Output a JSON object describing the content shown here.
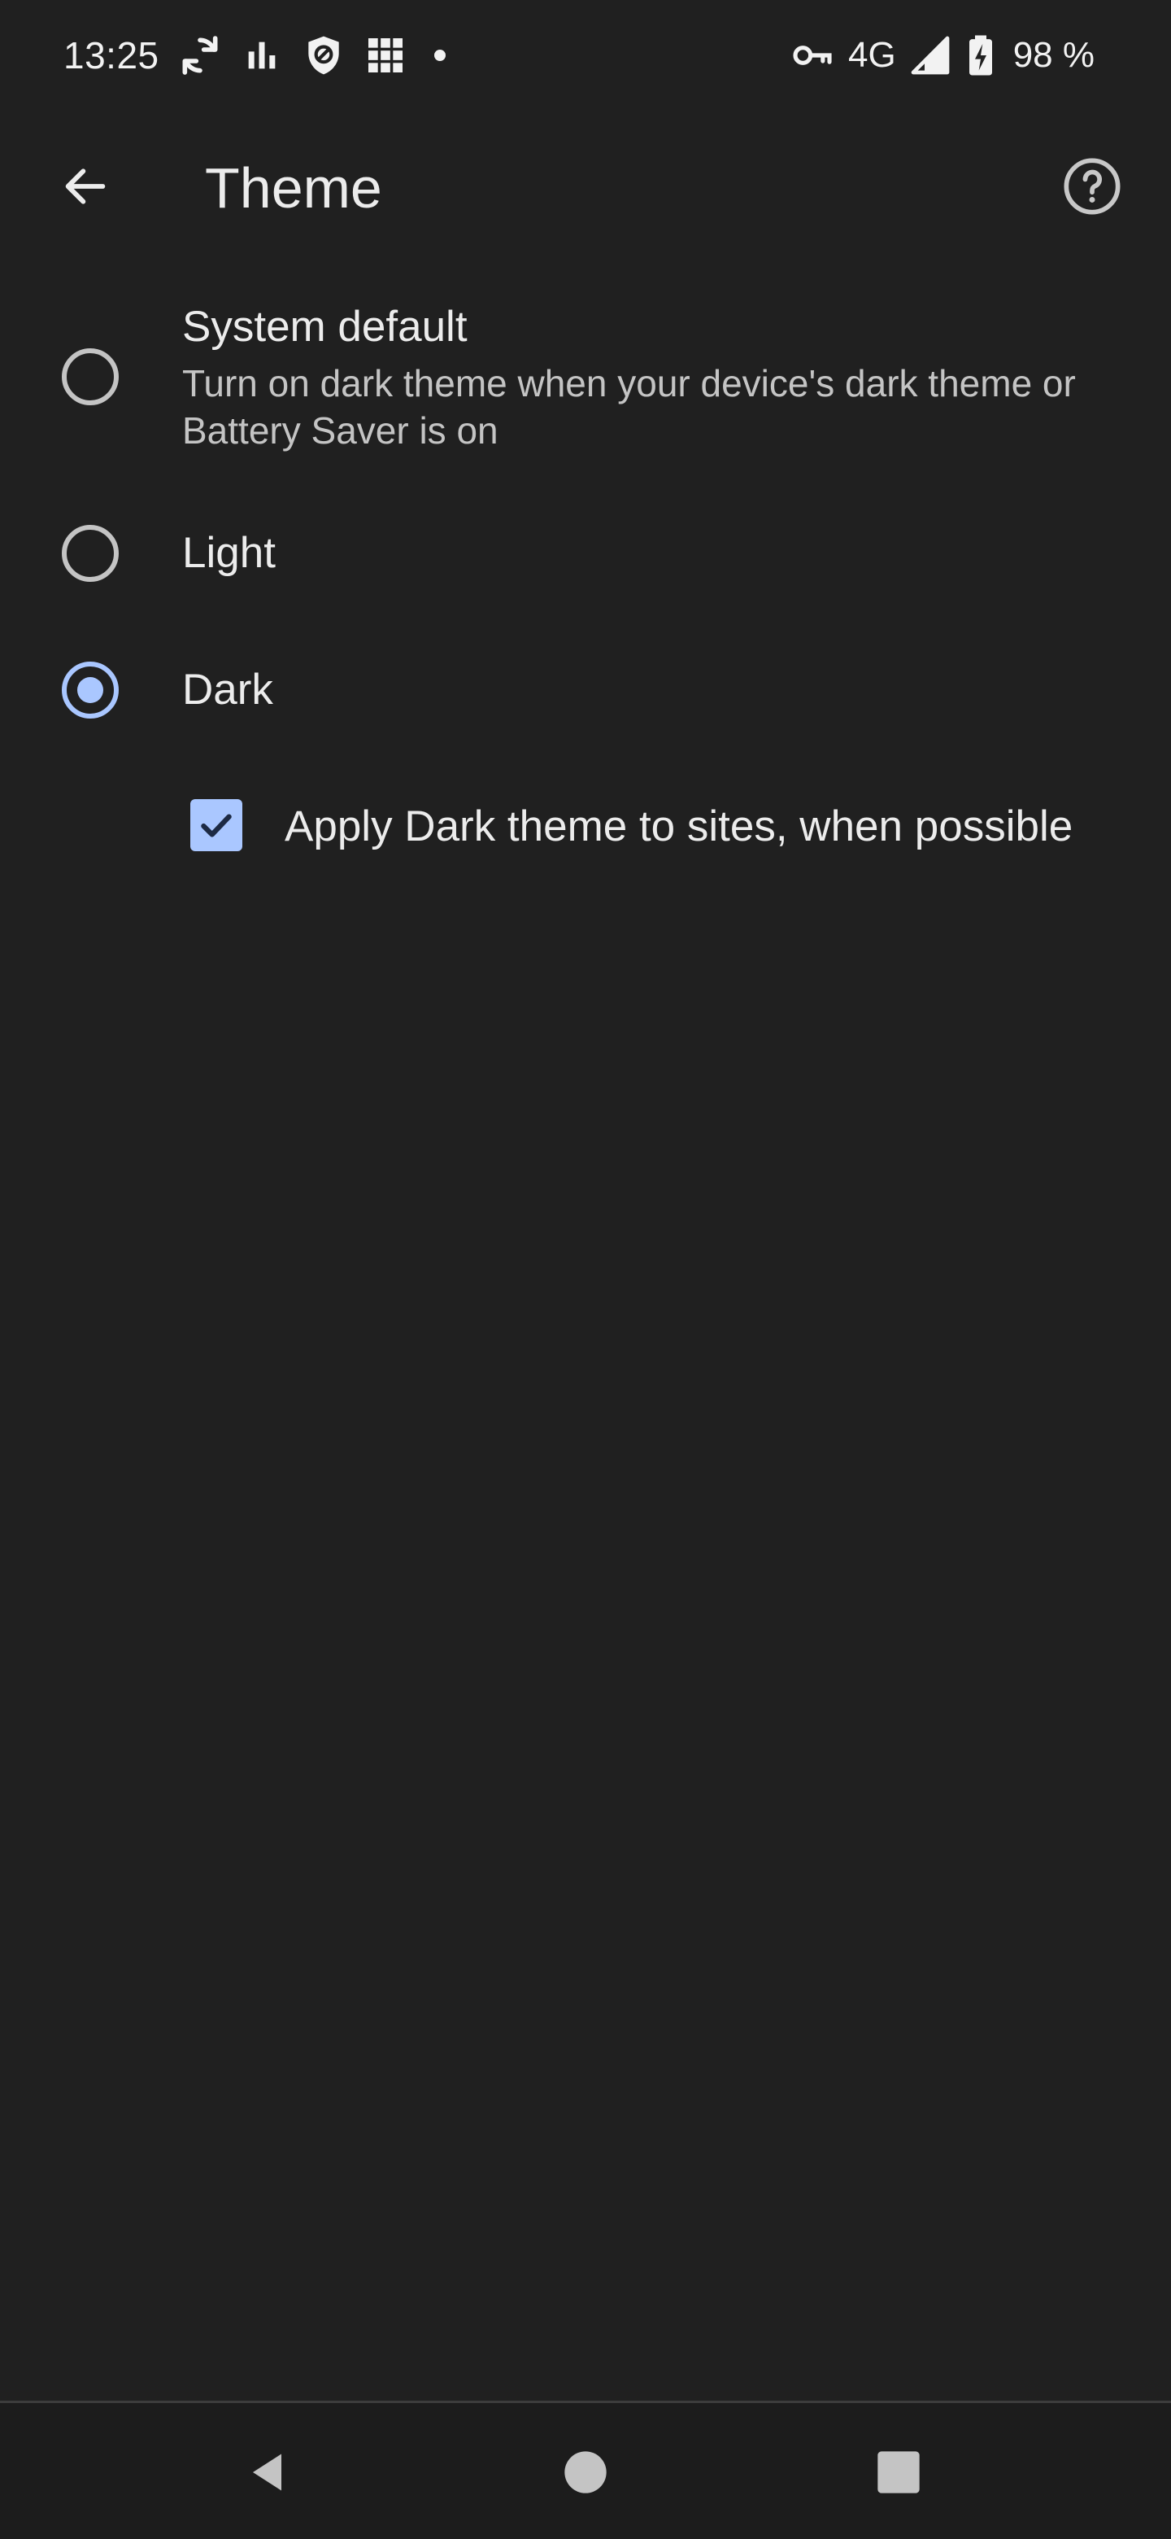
{
  "status_bar": {
    "time": "13:25",
    "network": "4G",
    "battery": "98 %",
    "icons_left": [
      "sync-icon",
      "bar-chart-icon",
      "shield-icon",
      "grid-icon",
      "notification-dot-icon"
    ],
    "icons_right": [
      "vpn-key-icon",
      "signal-icon",
      "battery-charging-icon"
    ]
  },
  "app_bar": {
    "title": "Theme",
    "back_icon": "arrow-back-icon",
    "help_icon": "help-icon"
  },
  "theme_options": [
    {
      "label": "System default",
      "summary": "Turn on dark theme when your device's dark theme or Battery Saver is on",
      "selected": false
    },
    {
      "label": "Light",
      "selected": false
    },
    {
      "label": "Dark",
      "selected": true
    }
  ],
  "dark_sites": {
    "label": "Apply Dark theme to sites, when possible",
    "checked": true
  },
  "nav_bar": {
    "buttons": [
      "back-triangle-icon",
      "home-circle-icon",
      "recents-square-icon"
    ]
  },
  "colors": {
    "background": "#202020",
    "accent": "#aac7ff",
    "text_primary": "#ececec",
    "text_secondary": "#c4c4c4"
  }
}
